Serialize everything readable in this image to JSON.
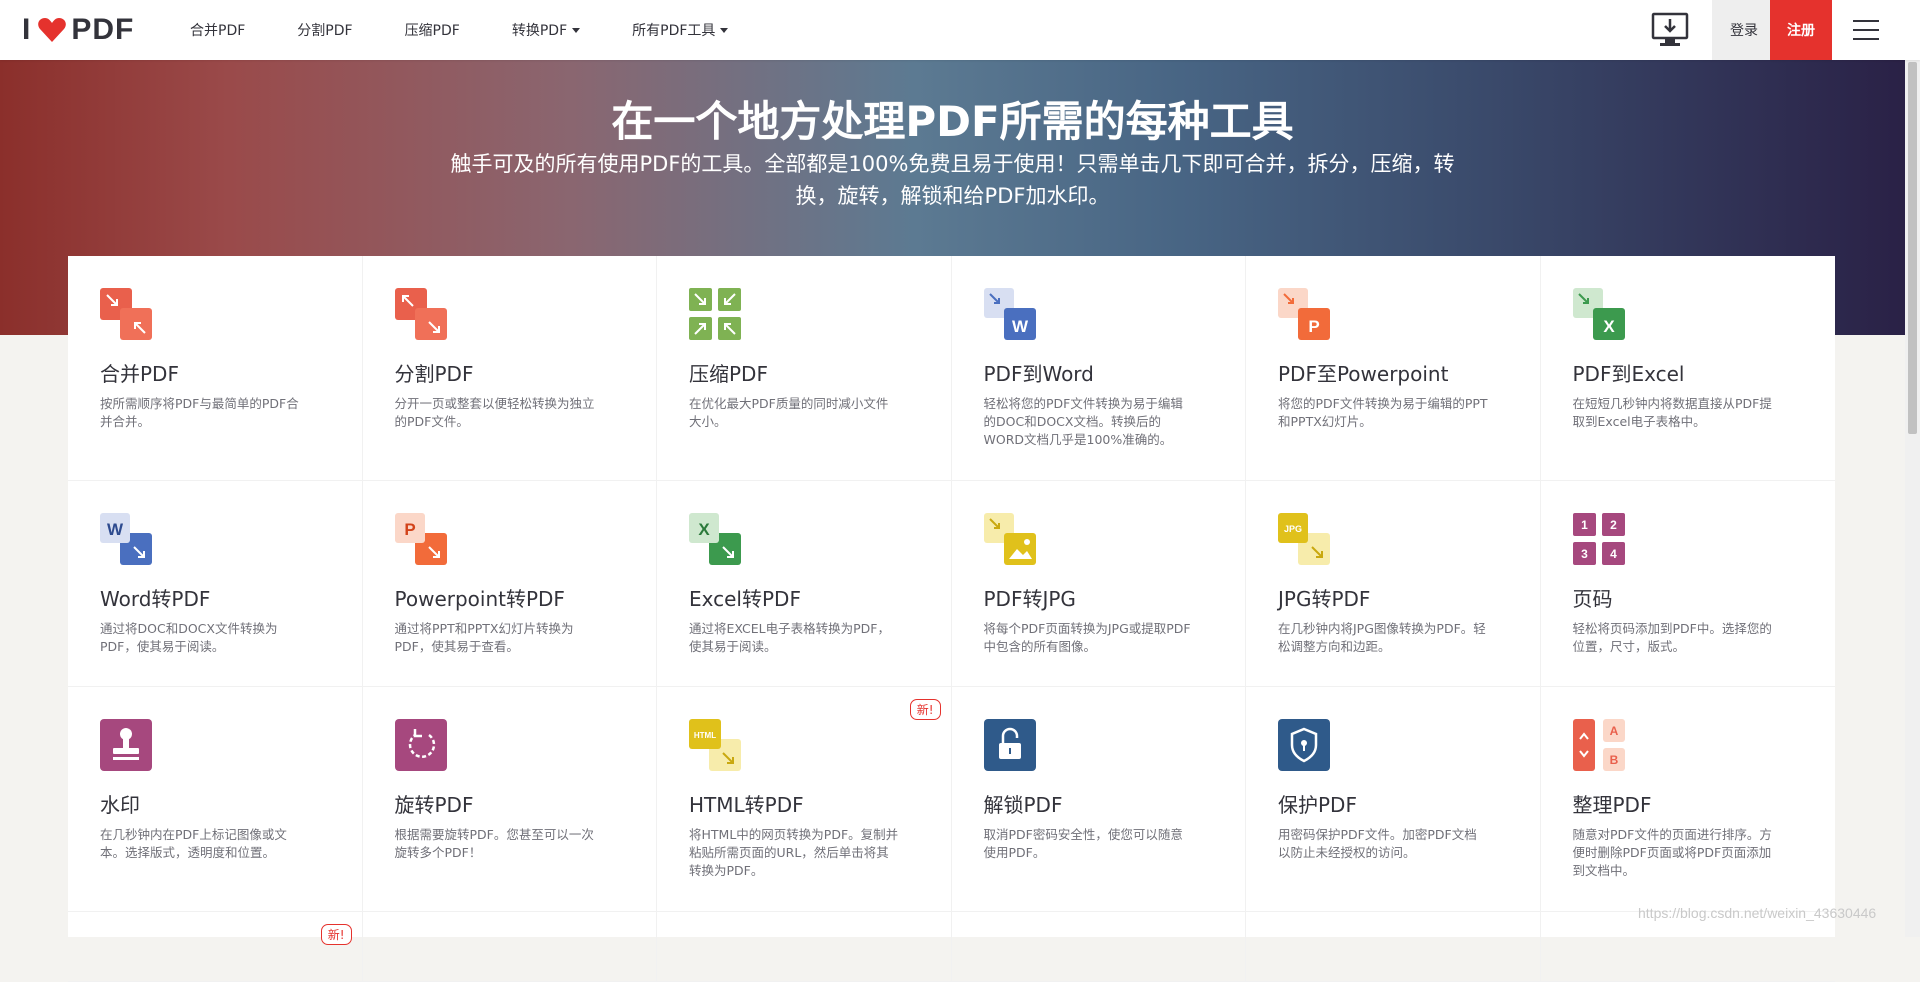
{
  "brand": {
    "logo_left": "I",
    "logo_right": "PDF"
  },
  "nav": {
    "items": [
      {
        "label": "合并PDF",
        "has_caret": false
      },
      {
        "label": "分割PDF",
        "has_caret": false
      },
      {
        "label": "压缩PDF",
        "has_caret": false
      },
      {
        "label": "转换PDF",
        "has_caret": true
      },
      {
        "label": "所有PDF工具",
        "has_caret": true
      }
    ],
    "login_label": "登录",
    "signup_label": "注册",
    "desktop_icon": "desktop-download-icon",
    "menu_icon": "hamburger-menu-icon"
  },
  "hero": {
    "title": "在一个地方处理PDF所需的每种工具",
    "subtitle": "触手可及的所有使用PDF的工具。全部都是100%免费且易于使用！只需单击几下即可合并，拆分，压缩，转换，旋转，解锁和给PDF加水印。"
  },
  "colors": {
    "accent_red": "#e5322d",
    "hero_start": "#8b2f2b",
    "hero_end": "#2a2146"
  },
  "tools": [
    {
      "id": "merge",
      "title": "合并PDF",
      "desc": "按所需顺序将PDF与最简单的PDF合并合并。",
      "icon": "merge-icon"
    },
    {
      "id": "split",
      "title": "分割PDF",
      "desc": "分开一页或整套以便轻松转换为独立的PDF文件。",
      "icon": "split-icon"
    },
    {
      "id": "compress",
      "title": "压缩PDF",
      "desc": "在优化最大PDF质量的同时减小文件大小。",
      "icon": "compress-icon"
    },
    {
      "id": "pdf2word",
      "title": "PDF到Word",
      "desc": "轻松将您的PDF文件转换为易于编辑的DOC和DOCX文档。转换后的WORD文档几乎是100%准确的。",
      "icon": "pdf-to-word-icon"
    },
    {
      "id": "pdf2ppt",
      "title": "PDF至Powerpoint",
      "desc": "将您的PDF文件转换为易于编辑的PPT和PPTX幻灯片。",
      "icon": "pdf-to-powerpoint-icon"
    },
    {
      "id": "pdf2excel",
      "title": "PDF到Excel",
      "desc": "在短短几秒钟内将数据直接从PDF提取到Excel电子表格中。",
      "icon": "pdf-to-excel-icon"
    },
    {
      "id": "word2pdf",
      "title": "Word转PDF",
      "desc": "通过将DOC和DOCX文件转换为PDF，使其易于阅读。",
      "icon": "word-to-pdf-icon"
    },
    {
      "id": "ppt2pdf",
      "title": "Powerpoint转PDF",
      "desc": "通过将PPT和PPTX幻灯片转换为PDF，使其易于查看。",
      "icon": "powerpoint-to-pdf-icon"
    },
    {
      "id": "excel2pdf",
      "title": "Excel转PDF",
      "desc": "通过将EXCEL电子表格转换为PDF，使其易于阅读。",
      "icon": "excel-to-pdf-icon"
    },
    {
      "id": "pdf2jpg",
      "title": "PDF转JPG",
      "desc": "将每个PDF页面转换为JPG或提取PDF中包含的所有图像。",
      "icon": "pdf-to-jpg-icon"
    },
    {
      "id": "jpg2pdf",
      "title": "JPG转PDF",
      "desc": "在几秒钟内将JPG图像转换为PDF。轻松调整方向和边距。",
      "icon": "jpg-to-pdf-icon"
    },
    {
      "id": "pagenum",
      "title": "页码",
      "desc": "轻松将页码添加到PDF中。选择您的位置，尺寸，版式。",
      "icon": "page-numbers-icon"
    },
    {
      "id": "watermark",
      "title": "水印",
      "desc": "在几秒钟内在PDF上标记图像或文本。选择版式，透明度和位置。",
      "icon": "watermark-stamp-icon"
    },
    {
      "id": "rotate",
      "title": "旋转PDF",
      "desc": "根据需要旋转PDF。您甚至可以一次旋转多个PDF！",
      "icon": "rotate-icon"
    },
    {
      "id": "html2pdf",
      "title": "HTML转PDF",
      "desc": "将HTML中的网页转换为PDF。复制并粘贴所需页面的URL，然后单击将其转换为PDF。",
      "icon": "html-to-pdf-icon",
      "badge": "新!"
    },
    {
      "id": "unlock",
      "title": "解锁PDF",
      "desc": "取消PDF密码安全性，使您可以随意使用PDF。",
      "icon": "unlock-icon"
    },
    {
      "id": "protect",
      "title": "保护PDF",
      "desc": "用密码保护PDF文件。加密PDF文档以防止未经授权的访问。",
      "icon": "protect-shield-icon"
    },
    {
      "id": "organize",
      "title": "整理PDF",
      "desc": "随意对PDF文件的页面进行排序。方便时删除PDF页面或将PDF页面添加到文档中。",
      "icon": "organize-icon"
    }
  ],
  "partial_row_badge": "新!",
  "watermark_text": "https://blog.csdn.net/weixin_43630446"
}
